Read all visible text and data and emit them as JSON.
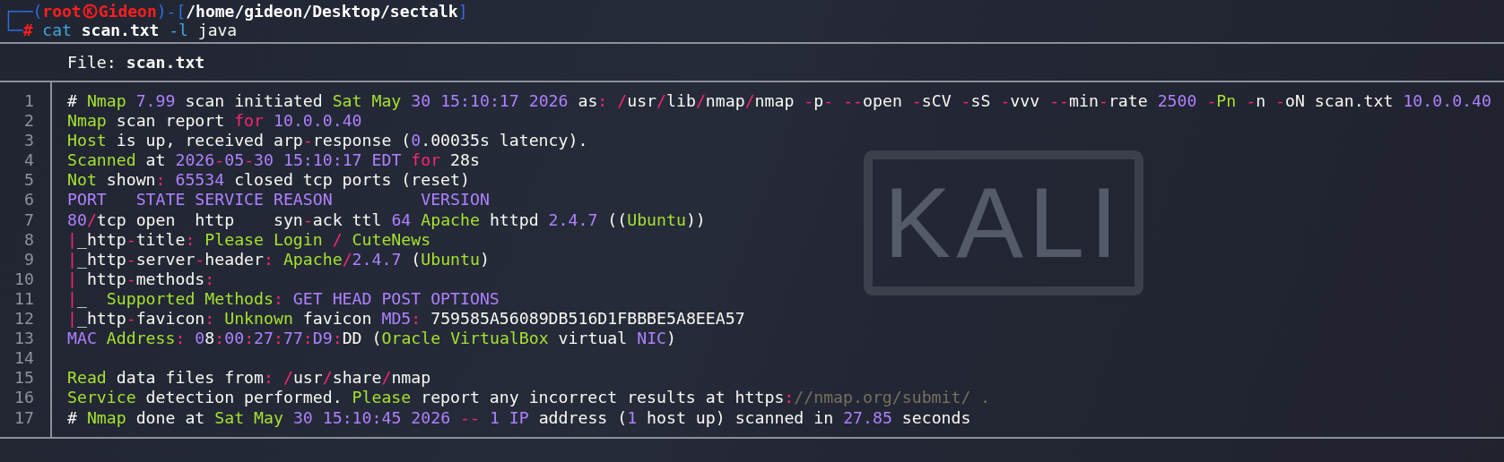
{
  "wallpaper": {
    "logo_text": "KALI"
  },
  "prompt": {
    "head": [
      {
        "kind": "frame",
        "text": "┌──("
      },
      {
        "kind": "user",
        "text": "root"
      }
    ],
    "tail": [
      {
        "kind": "user",
        "text": "Gideon"
      },
      {
        "kind": "frame",
        "text": ")-["
      },
      {
        "kind": "path",
        "text": "/home/gideon/Desktop/sectalk"
      },
      {
        "kind": "frame",
        "text": "]"
      }
    ],
    "command": [
      {
        "kind": "frame",
        "text": "└─"
      },
      {
        "kind": "user",
        "text": "#"
      },
      {
        "kind": "command",
        "text": " cat"
      },
      {
        "kind": "path",
        "text": " scan.txt"
      },
      {
        "kind": "command",
        "text": " -l"
      },
      {
        "kind": "plain",
        "text": " java"
      }
    ]
  },
  "file_header": "File: **scan.txt**",
  "lines": [
    {
      "number": "1",
      "segments": [
        {
          "kind": "plain",
          "text": "# "
        },
        {
          "kind": "name",
          "text": "Nmap"
        },
        {
          "kind": "number",
          "text": " 7.99"
        },
        {
          "kind": "plain",
          "text": " scan initiated "
        },
        {
          "kind": "name",
          "text": "Sat May"
        },
        {
          "kind": "number",
          "text": " 30 15:10:17 2026"
        },
        {
          "kind": "plain",
          "text": " as"
        },
        {
          "kind": "symbol",
          "text": ":"
        },
        {
          "kind": "symbol",
          "text": " /"
        },
        {
          "kind": "plain",
          "text": "usr"
        },
        {
          "kind": "symbol",
          "text": "/"
        },
        {
          "kind": "plain",
          "text": "lib"
        },
        {
          "kind": "symbol",
          "text": "/"
        },
        {
          "kind": "plain",
          "text": "nmap"
        },
        {
          "kind": "symbol",
          "text": "/"
        },
        {
          "kind": "plain",
          "text": "nmap "
        },
        {
          "kind": "symbol",
          "text": "-"
        },
        {
          "kind": "plain",
          "text": "p"
        },
        {
          "kind": "symbol",
          "text": "-"
        },
        {
          "kind": "symbol",
          "text": " --"
        },
        {
          "kind": "plain",
          "text": "open "
        },
        {
          "kind": "symbol",
          "text": "-"
        },
        {
          "kind": "plain",
          "text": "sCV "
        },
        {
          "kind": "symbol",
          "text": "-"
        },
        {
          "kind": "plain",
          "text": "sS "
        },
        {
          "kind": "symbol",
          "text": "-"
        },
        {
          "kind": "plain",
          "text": "vvv "
        },
        {
          "kind": "symbol",
          "text": "--"
        },
        {
          "kind": "plain",
          "text": "min"
        },
        {
          "kind": "symbol",
          "text": "-"
        },
        {
          "kind": "plain",
          "text": "rate "
        },
        {
          "kind": "number",
          "text": "2500"
        },
        {
          "kind": "symbol",
          "text": " -"
        },
        {
          "kind": "name",
          "text": "Pn"
        },
        {
          "kind": "symbol",
          "text": " -"
        },
        {
          "kind": "plain",
          "text": "n "
        },
        {
          "kind": "symbol",
          "text": "-"
        },
        {
          "kind": "plain",
          "text": "oN scan.txt "
        },
        {
          "kind": "number",
          "text": "10.0.0.40"
        }
      ]
    },
    {
      "number": "2",
      "segments": [
        {
          "kind": "name",
          "text": "Nmap"
        },
        {
          "kind": "plain",
          "text": " scan report "
        },
        {
          "kind": "symbol",
          "text": "for"
        },
        {
          "kind": "number",
          "text": " 10.0.0.40"
        }
      ]
    },
    {
      "number": "3",
      "segments": [
        {
          "kind": "name",
          "text": "Host"
        },
        {
          "kind": "plain",
          "text": " is up, received arp"
        },
        {
          "kind": "symbol",
          "text": "-"
        },
        {
          "kind": "plain",
          "text": "response ("
        },
        {
          "kind": "number",
          "text": "0"
        },
        {
          "kind": "plain",
          "text": ".00035s latency)."
        }
      ]
    },
    {
      "number": "4",
      "segments": [
        {
          "kind": "name",
          "text": "Scanned"
        },
        {
          "kind": "plain",
          "text": " at "
        },
        {
          "kind": "number",
          "text": "2026"
        },
        {
          "kind": "symbol",
          "text": "-"
        },
        {
          "kind": "number",
          "text": "05"
        },
        {
          "kind": "symbol",
          "text": "-"
        },
        {
          "kind": "number",
          "text": "30 15:10:17 EDT"
        },
        {
          "kind": "symbol",
          "text": " for"
        },
        {
          "kind": "plain",
          "text": " 28s"
        }
      ]
    },
    {
      "number": "5",
      "segments": [
        {
          "kind": "name",
          "text": "Not"
        },
        {
          "kind": "plain",
          "text": " shown"
        },
        {
          "kind": "symbol",
          "text": ":"
        },
        {
          "kind": "number",
          "text": " 65534"
        },
        {
          "kind": "plain",
          "text": " closed tcp ports (reset)"
        }
      ]
    },
    {
      "number": "6",
      "segments": [
        {
          "kind": "number",
          "text": "PORT   STATE SERVICE REASON         VERSION"
        }
      ]
    },
    {
      "number": "7",
      "segments": [
        {
          "kind": "number",
          "text": "80"
        },
        {
          "kind": "symbol",
          "text": "/"
        },
        {
          "kind": "plain",
          "text": "tcp open  http    syn"
        },
        {
          "kind": "symbol",
          "text": "-"
        },
        {
          "kind": "plain",
          "text": "ack ttl "
        },
        {
          "kind": "number",
          "text": "64"
        },
        {
          "kind": "name",
          "text": " Apache"
        },
        {
          "kind": "plain",
          "text": " httpd "
        },
        {
          "kind": "number",
          "text": "2.4.7"
        },
        {
          "kind": "plain",
          "text": " (("
        },
        {
          "kind": "name",
          "text": "Ubuntu"
        },
        {
          "kind": "plain",
          "text": "))"
        }
      ]
    },
    {
      "number": "8",
      "segments": [
        {
          "kind": "symbol",
          "text": "|"
        },
        {
          "kind": "plain",
          "text": "_http"
        },
        {
          "kind": "symbol",
          "text": "-"
        },
        {
          "kind": "plain",
          "text": "title"
        },
        {
          "kind": "symbol",
          "text": ":"
        },
        {
          "kind": "name",
          "text": " Please Login "
        },
        {
          "kind": "symbol",
          "text": "/"
        },
        {
          "kind": "name",
          "text": " CuteNews"
        }
      ]
    },
    {
      "number": "9",
      "segments": [
        {
          "kind": "symbol",
          "text": "|"
        },
        {
          "kind": "plain",
          "text": "_http"
        },
        {
          "kind": "symbol",
          "text": "-"
        },
        {
          "kind": "plain",
          "text": "server"
        },
        {
          "kind": "symbol",
          "text": "-"
        },
        {
          "kind": "plain",
          "text": "header"
        },
        {
          "kind": "symbol",
          "text": ":"
        },
        {
          "kind": "name",
          "text": " Apache"
        },
        {
          "kind": "symbol",
          "text": "/"
        },
        {
          "kind": "number",
          "text": "2.4.7"
        },
        {
          "kind": "plain",
          "text": " ("
        },
        {
          "kind": "name",
          "text": "Ubuntu"
        },
        {
          "kind": "plain",
          "text": ")"
        }
      ]
    },
    {
      "number": "10",
      "segments": [
        {
          "kind": "symbol",
          "text": "|"
        },
        {
          "kind": "plain",
          "text": " http"
        },
        {
          "kind": "symbol",
          "text": "-"
        },
        {
          "kind": "plain",
          "text": "methods"
        },
        {
          "kind": "symbol",
          "text": ":"
        }
      ]
    },
    {
      "number": "11",
      "segments": [
        {
          "kind": "symbol",
          "text": "|"
        },
        {
          "kind": "plain",
          "text": "_  "
        },
        {
          "kind": "name",
          "text": "Supported Methods"
        },
        {
          "kind": "symbol",
          "text": ":"
        },
        {
          "kind": "number",
          "text": " GET HEAD POST OPTIONS"
        }
      ]
    },
    {
      "number": "12",
      "segments": [
        {
          "kind": "symbol",
          "text": "|"
        },
        {
          "kind": "plain",
          "text": "_http"
        },
        {
          "kind": "symbol",
          "text": "-"
        },
        {
          "kind": "plain",
          "text": "favicon"
        },
        {
          "kind": "symbol",
          "text": ":"
        },
        {
          "kind": "name",
          "text": " Unknown"
        },
        {
          "kind": "plain",
          "text": " favicon "
        },
        {
          "kind": "number",
          "text": "MD5"
        },
        {
          "kind": "symbol",
          "text": ":"
        },
        {
          "kind": "plain",
          "text": " 759585A56089DB516D1FBBBE5A8EEA57"
        }
      ]
    },
    {
      "number": "13",
      "segments": [
        {
          "kind": "number",
          "text": "MAC"
        },
        {
          "kind": "name",
          "text": " Address"
        },
        {
          "kind": "symbol",
          "text": ":"
        },
        {
          "kind": "number",
          "text": " 0"
        },
        {
          "kind": "plain",
          "text": "8"
        },
        {
          "kind": "symbol",
          "text": ":"
        },
        {
          "kind": "number",
          "text": "00"
        },
        {
          "kind": "symbol",
          "text": ":"
        },
        {
          "kind": "number",
          "text": "27"
        },
        {
          "kind": "symbol",
          "text": ":"
        },
        {
          "kind": "number",
          "text": "77"
        },
        {
          "kind": "symbol",
          "text": ":"
        },
        {
          "kind": "number",
          "text": "D9"
        },
        {
          "kind": "symbol",
          "text": ":"
        },
        {
          "kind": "plain",
          "text": "DD ("
        },
        {
          "kind": "name",
          "text": "Oracle VirtualBox"
        },
        {
          "kind": "plain",
          "text": " virtual "
        },
        {
          "kind": "number",
          "text": "NIC"
        },
        {
          "kind": "plain",
          "text": ")"
        }
      ]
    },
    {
      "number": "14"
    },
    {
      "number": "15",
      "segments": [
        {
          "kind": "name",
          "text": "Read"
        },
        {
          "kind": "plain",
          "text": " data files from"
        },
        {
          "kind": "symbol",
          "text": ":"
        },
        {
          "kind": "symbol",
          "text": " /"
        },
        {
          "kind": "plain",
          "text": "usr"
        },
        {
          "kind": "symbol",
          "text": "/"
        },
        {
          "kind": "plain",
          "text": "share"
        },
        {
          "kind": "symbol",
          "text": "/"
        },
        {
          "kind": "plain",
          "text": "nmap"
        }
      ]
    },
    {
      "number": "16",
      "segments": [
        {
          "kind": "name",
          "text": "Service"
        },
        {
          "kind": "plain",
          "text": " detection performed. "
        },
        {
          "kind": "name",
          "text": "Please"
        },
        {
          "kind": "plain",
          "text": " report any incorrect results at https"
        },
        {
          "kind": "symbol",
          "text": ":"
        },
        {
          "kind": "comment",
          "text": "//nmap.org/submit/ ."
        }
      ]
    },
    {
      "number": "17",
      "segments": [
        {
          "kind": "plain",
          "text": "# "
        },
        {
          "kind": "name",
          "text": "Nmap"
        },
        {
          "kind": "plain",
          "text": " done at "
        },
        {
          "kind": "name",
          "text": "Sat May"
        },
        {
          "kind": "number",
          "text": " 30 15:10:45 2026"
        },
        {
          "kind": "symbol",
          "text": " --"
        },
        {
          "kind": "number",
          "text": " 1"
        },
        {
          "kind": "number",
          "text": " IP"
        },
        {
          "kind": "plain",
          "text": " address ("
        },
        {
          "kind": "number",
          "text": "1"
        },
        {
          "kind": "plain",
          "text": " host up) scanned in "
        },
        {
          "kind": "number",
          "text": "27.85"
        },
        {
          "kind": "plain",
          "text": " seconds"
        }
      ]
    }
  ]
}
